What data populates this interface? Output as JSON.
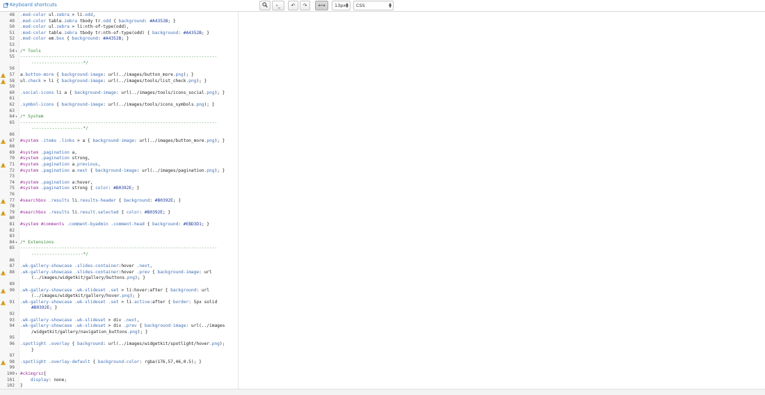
{
  "toolbar": {
    "shortcuts_link": "Keyboard shortcuts",
    "font_size": "13px",
    "mode": "CSS",
    "buttons": [
      {
        "icon": "search-icon",
        "glyph": "🔍"
      },
      {
        "icon": "terminal-icon",
        "glyph": "›_"
      },
      {
        "icon": "undo-icon",
        "glyph": "↶"
      },
      {
        "icon": "redo-icon",
        "glyph": "↷"
      },
      {
        "icon": "wrap-toggle-icon",
        "glyph": "⟷"
      }
    ]
  },
  "editor": {
    "lines": [
      {
        "n": "48",
        "t": ".mod-color ul.zebra > li.odd,"
      },
      {
        "n": "49",
        "t": ".mod-color table.zebra tbody tr.odd { background: #A4352B; }"
      },
      {
        "n": "50",
        "t": ".mod-color ul.zebra > li:nth-of-type(odd),"
      },
      {
        "n": "51",
        "t": ".mod-color table.zebra tbody tr:nth-of-type(odd) { background: #A4352B; }"
      },
      {
        "n": "52",
        "t": ".mod-color em.box { background: #A4352B; }"
      },
      {
        "n": "53",
        "t": ""
      },
      {
        "n": "54",
        "t": "/* Tools",
        "fold": true
      },
      {
        "n": "55",
        "t": "----------------------------------------------------------------------------"
      },
      {
        "n": "",
        "t": "--------------------*/",
        "wrap": true
      },
      {
        "n": "56",
        "t": ""
      },
      {
        "n": "57",
        "t": "a.button-more { background-image: url(../images/button_more.png); }",
        "warn": true
      },
      {
        "n": "58",
        "t": "ul.check > li { background-image: url(../images/tools/list_check.png); }",
        "warn": true
      },
      {
        "n": "59",
        "t": ""
      },
      {
        "n": "60",
        "t": ".social-icons li a { background-image: url(../images/tools/icons_social.png); }"
      },
      {
        "n": "61",
        "t": ""
      },
      {
        "n": "62",
        "t": ".symbol-icons { background-image: url(../images/tools/icons_symbols.png); }"
      },
      {
        "n": "63",
        "t": ""
      },
      {
        "n": "64",
        "t": "/* System",
        "fold": true
      },
      {
        "n": "65",
        "t": "----------------------------------------------------------------------------"
      },
      {
        "n": "",
        "t": "--------------------*/",
        "wrap": true
      },
      {
        "n": "66",
        "t": ""
      },
      {
        "n": "67",
        "t": "#system .items .links > a { background-image: url(../images/button_more.png); }",
        "warn": true
      },
      {
        "n": "68",
        "t": ""
      },
      {
        "n": "69",
        "t": "#system .pagination a,"
      },
      {
        "n": "70",
        "t": "#system .pagination strong,"
      },
      {
        "n": "71",
        "t": "#system .pagination a.previous,",
        "warn": true
      },
      {
        "n": "72",
        "t": "#system .pagination a.next { background-image: url(../images/pagination.png); }"
      },
      {
        "n": "73",
        "t": ""
      },
      {
        "n": "74",
        "t": "#system .pagination a:hover,"
      },
      {
        "n": "75",
        "t": "#system .pagination strong { color: #B0392E; }"
      },
      {
        "n": "76",
        "t": ""
      },
      {
        "n": "77",
        "t": "#searchbox .results li.results-header { background: #B0392E; }",
        "warn": true
      },
      {
        "n": "78",
        "t": ""
      },
      {
        "n": "79",
        "t": "#searchbox .results li.result.selected { color: #B0392E; }",
        "warn": true
      },
      {
        "n": "80",
        "t": ""
      },
      {
        "n": "81",
        "t": "#system #comments .comment-byadmin .comment-head { background: #EBD3D1; }"
      },
      {
        "n": "82",
        "t": ""
      },
      {
        "n": "83",
        "t": ""
      },
      {
        "n": "84",
        "t": "/* Extensions",
        "fold": true
      },
      {
        "n": "85",
        "t": "----------------------------------------------------------------------------"
      },
      {
        "n": "",
        "t": "--------------------*/",
        "wrap": true
      },
      {
        "n": "86",
        "t": ""
      },
      {
        "n": "87",
        "t": ".wk-gallery-showcase .slides-container:hover .next,"
      },
      {
        "n": "88",
        "t": ".wk-gallery-showcase .slides-container:hover .prev { background-image: url",
        "warn": true
      },
      {
        "n": "",
        "t": "(../images/widgetkit/gallery/buttons.png); }",
        "wrap": true
      },
      {
        "n": "89",
        "t": ""
      },
      {
        "n": "90",
        "t": ".wk-gallery-showcase .wk-slideset .set > li:hover:after { background: url",
        "warn": true
      },
      {
        "n": "",
        "t": "(../images/widgetkit/gallery/hover.png); }",
        "wrap": true
      },
      {
        "n": "91",
        "t": ".wk-gallery-showcase .wk-slideset .set > li.active:after { border: 5px solid",
        "warn": true
      },
      {
        "n": "",
        "t": "#B0392E; }",
        "wrap": true
      },
      {
        "n": "92",
        "t": ""
      },
      {
        "n": "93",
        "t": ".wk-gallery-showcase .wk-slideset > div .next,"
      },
      {
        "n": "94",
        "t": ".wk-gallery-showcase .wk-slideset > div .prev { background-image: url(../images"
      },
      {
        "n": "",
        "t": "/widgetkit/gallery/navigation_buttons.png); }",
        "wrap": true
      },
      {
        "n": "95",
        "t": ""
      },
      {
        "n": "96",
        "t": ".spotlight .overlay { background: url(../images/widgetkit/spotlight/hover.png);"
      },
      {
        "n": "",
        "t": "}",
        "wrap": true
      },
      {
        "n": "97",
        "t": ""
      },
      {
        "n": "98",
        "t": ".spotlight .overlay-default { background-color: rgba(176,57,46,0.5); }",
        "warn": true
      },
      {
        "n": "99",
        "t": ""
      },
      {
        "n": "100",
        "t": "#ckimgrsz{",
        "fold": true
      },
      {
        "n": "101",
        "t": "    display: none;"
      },
      {
        "n": "102",
        "t": "}"
      }
    ]
  }
}
